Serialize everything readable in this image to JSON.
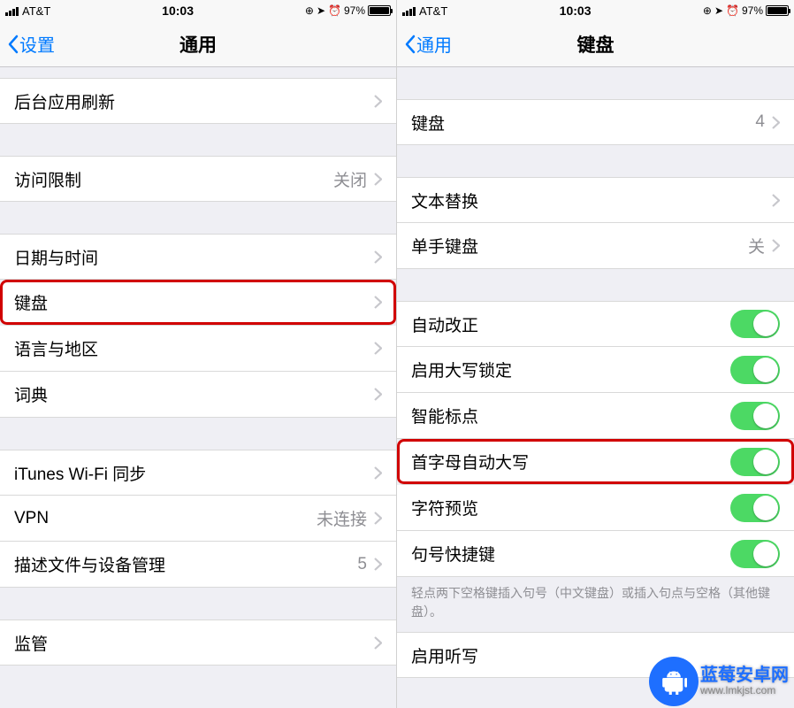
{
  "status": {
    "carrier": "AT&T",
    "time": "10:03",
    "battery_pct": "97%"
  },
  "left": {
    "back_label": "设置",
    "title": "通用",
    "rows": {
      "bg_refresh": "后台应用刷新",
      "restrict": {
        "label": "访问限制",
        "value": "关闭"
      },
      "date_time": "日期与时间",
      "keyboard": "键盘",
      "lang_region": "语言与地区",
      "dict": "词典",
      "itunes_wifi": "iTunes Wi-Fi 同步",
      "vpn": {
        "label": "VPN",
        "value": "未连接"
      },
      "profiles": {
        "label": "描述文件与设备管理",
        "value": "5"
      },
      "supervision": "监管"
    }
  },
  "right": {
    "back_label": "通用",
    "title": "键盘",
    "rows": {
      "keyboards": {
        "label": "键盘",
        "value": "4"
      },
      "text_replace": "文本替换",
      "one_hand": {
        "label": "单手键盘",
        "value": "关"
      },
      "auto_correct": "自动改正",
      "caps_lock": "启用大写锁定",
      "smart_punct": "智能标点",
      "auto_caps": "首字母自动大写",
      "char_preview": "字符预览",
      "period_shortcut": "句号快捷键",
      "footer": "轻点两下空格键插入句号（中文键盘）或插入句点与空格（其他键盘）。",
      "dictation": "启用听写"
    }
  },
  "watermark": {
    "title": "蓝莓安卓网",
    "url": "www.lmkjst.com"
  }
}
